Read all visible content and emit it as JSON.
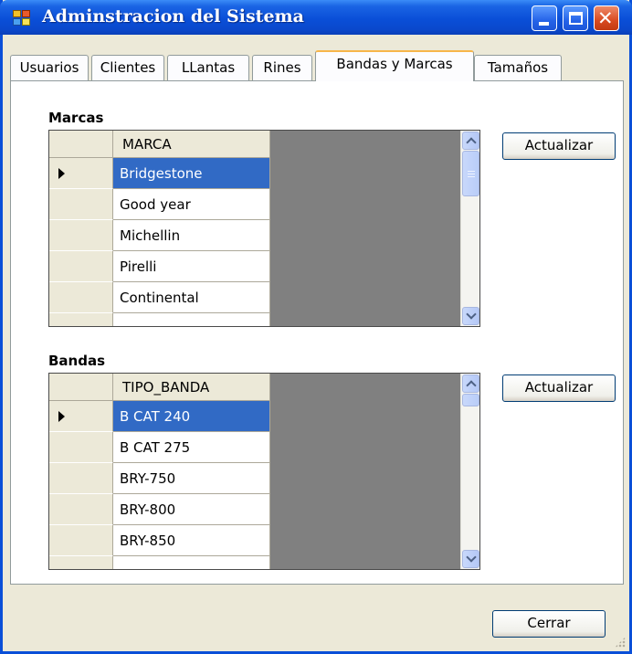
{
  "window": {
    "title": "Adminstracion del Sistema"
  },
  "tabs": [
    {
      "label": "Usuarios",
      "active": false
    },
    {
      "label": "Clientes",
      "active": false
    },
    {
      "label": "LLantas",
      "active": false
    },
    {
      "label": "Rines",
      "active": false
    },
    {
      "label": "Bandas y Marcas",
      "active": true
    },
    {
      "label": "Tamaños",
      "active": false
    }
  ],
  "marcas": {
    "label": "Marcas",
    "column": "MARCA",
    "rows": [
      "Bridgestone",
      "Good year",
      "Michellin",
      "Pirelli",
      "Continental"
    ],
    "selected_index": 0,
    "refresh_label": "Actualizar"
  },
  "bandas": {
    "label": "Bandas",
    "column": "TIPO_BANDA",
    "rows": [
      "B CAT 240",
      "B CAT 275",
      "BRY-750",
      "BRY-800",
      "BRY-850"
    ],
    "selected_index": 0,
    "refresh_label": "Actualizar"
  },
  "footer": {
    "close_label": "Cerrar"
  },
  "colors": {
    "titlebar": "#0a4fd8",
    "selection": "#316ac5",
    "grid_background": "#808080"
  }
}
